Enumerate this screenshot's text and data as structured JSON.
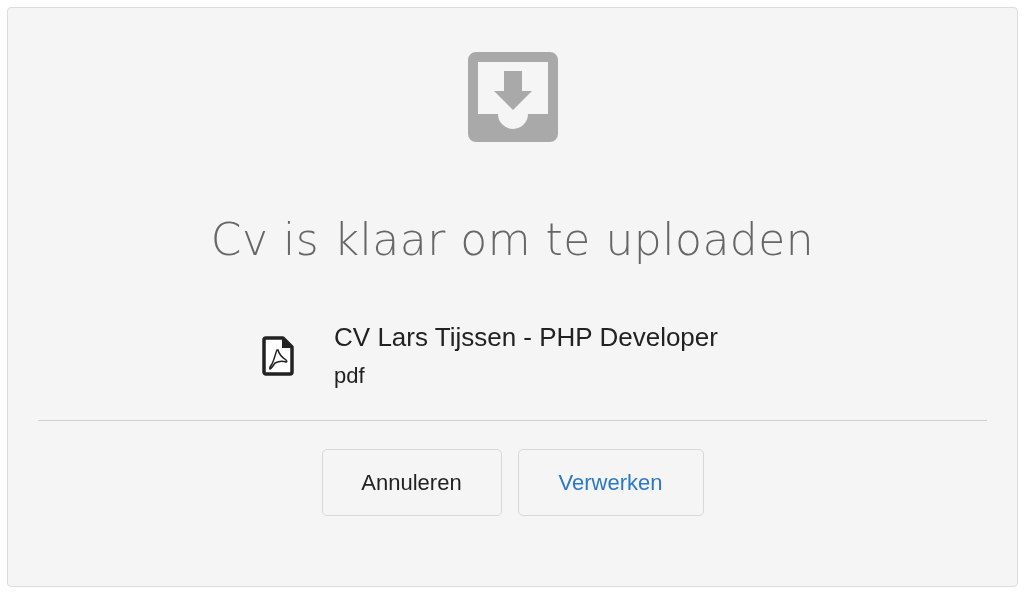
{
  "dialog": {
    "title": "Cv is klaar om te uploaden",
    "file": {
      "name": "CV Lars Tijssen - PHP Developer",
      "type": "pdf"
    },
    "buttons": [
      {
        "label": "Annuleren",
        "kind": "cancel"
      },
      {
        "label": "Verwerken",
        "kind": "primary"
      }
    ]
  }
}
